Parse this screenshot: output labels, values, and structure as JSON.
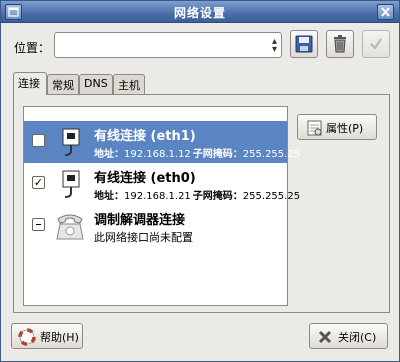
{
  "window": {
    "title": "网络设置"
  },
  "location": {
    "label": "位置：",
    "value": ""
  },
  "tabs": [
    {
      "label": "连接"
    },
    {
      "label": "常规"
    },
    {
      "label": "DNS"
    },
    {
      "label": "主机"
    }
  ],
  "connections": [
    {
      "name": "有线连接 (eth1)",
      "address_label": "地址：",
      "address": "192.168.1.12",
      "mask_label": "子网掩码：",
      "mask": "255.255.25",
      "checked": false,
      "selected": true
    },
    {
      "name": "有线连接 (eth0)",
      "address_label": "地址：",
      "address": "192.168.1.21",
      "mask_label": "子网掩码：",
      "mask": "255.255.25",
      "checked": true,
      "selected": false
    },
    {
      "name": "调制解调器连接",
      "status": "此网络接口尚未配置",
      "checked": false,
      "selected": false
    }
  ],
  "buttons": {
    "properties": "属性(P)",
    "help": "帮助(H)",
    "close": "关闭(C)"
  },
  "icons": {
    "window_menu": "window-menu-icon",
    "window_close": "close-icon",
    "save": "save-icon",
    "delete": "trash-icon",
    "apply": "checkmark-icon",
    "ethernet": "ethernet-plug-icon",
    "modem": "modem-phone-icon",
    "properties": "properties-icon",
    "help": "lifebuoy-icon",
    "close": "close-x-icon"
  },
  "colors": {
    "titlebar": "#4a6fa8",
    "selection": "#5b84c3",
    "window_bg": "#eceae6"
  }
}
